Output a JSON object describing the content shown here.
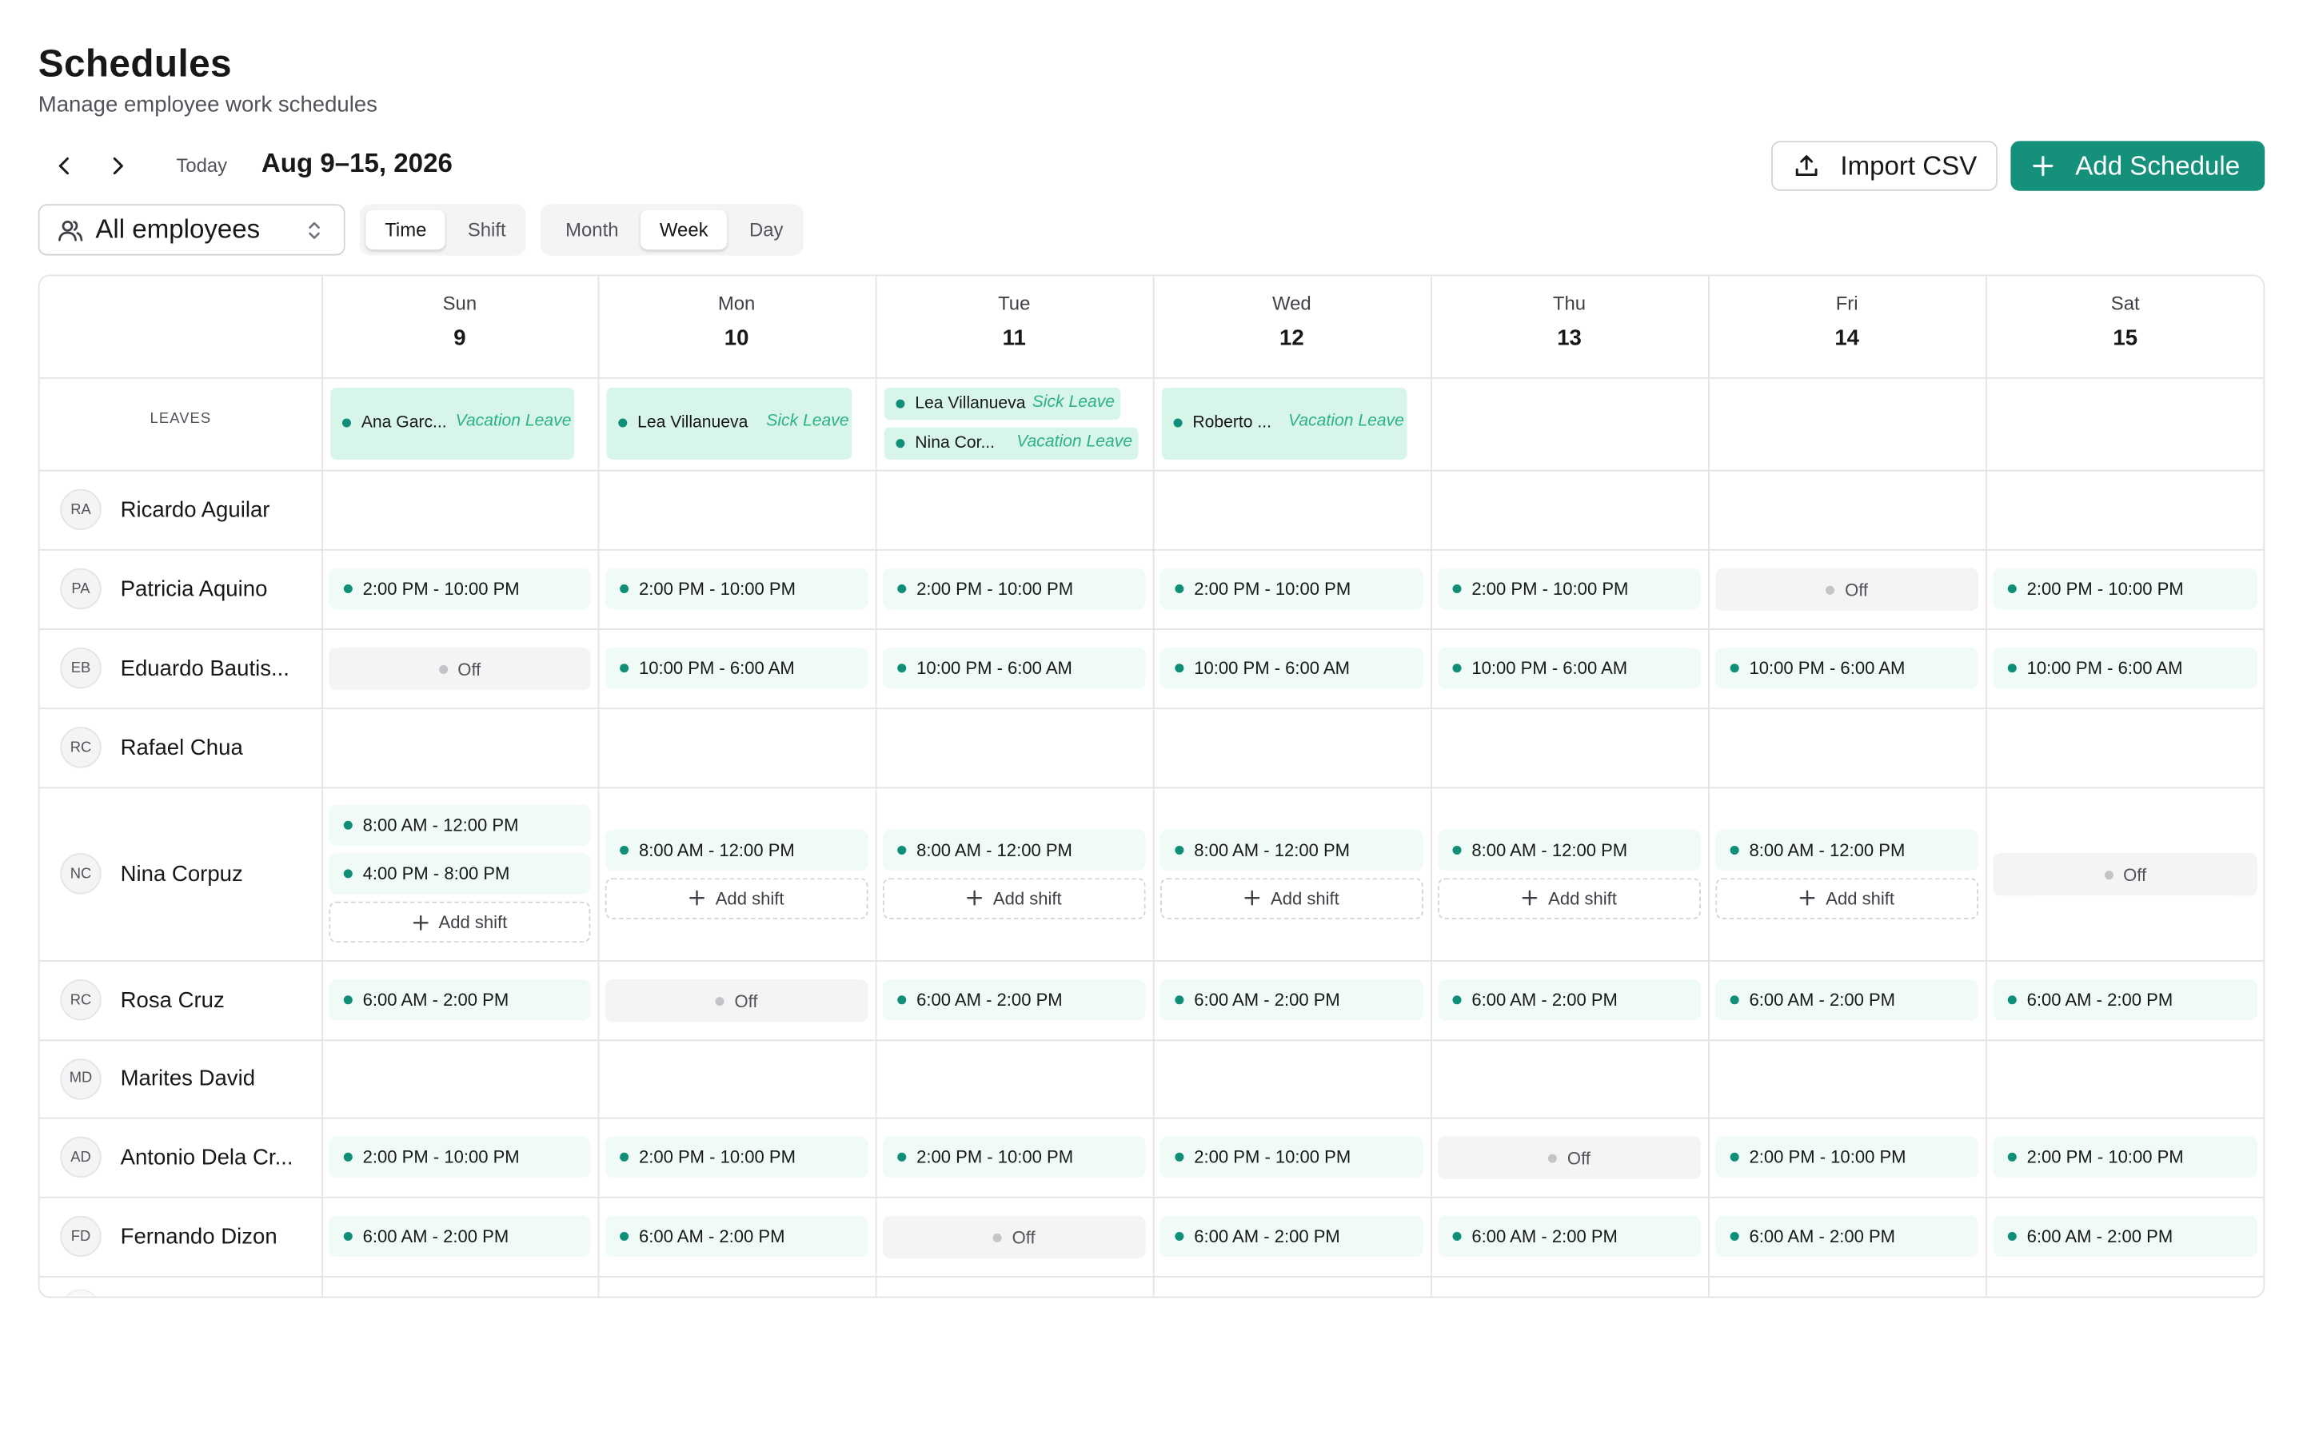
{
  "header": {
    "title": "Schedules",
    "subtitle": "Manage employee work schedules"
  },
  "nav": {
    "prev_icon": "chevron-left-icon",
    "next_icon": "chevron-right-icon",
    "today_label": "Today",
    "range": "Aug 9–15, 2026"
  },
  "actions": {
    "import_label": "Import CSV",
    "import_icon": "upload-icon",
    "add_label": "Add Schedule",
    "add_icon": "plus-icon"
  },
  "filters": {
    "employee_select": "All employees",
    "employee_icon": "users-icon",
    "view_mode": [
      {
        "label": "Time",
        "active": true
      },
      {
        "label": "Shift",
        "active": false
      }
    ],
    "period": [
      {
        "label": "Month",
        "active": false
      },
      {
        "label": "Week",
        "active": true
      },
      {
        "label": "Day",
        "active": false
      }
    ]
  },
  "colors": {
    "accent": "#14907b",
    "shift_bg": "#f0fbf8",
    "leave_bg": "#d7f5e8",
    "leave_type": "#2bb384",
    "off_bg": "#f4f4f5"
  },
  "days": [
    {
      "name": "Sun",
      "num": "9"
    },
    {
      "name": "Mon",
      "num": "10"
    },
    {
      "name": "Tue",
      "num": "11"
    },
    {
      "name": "Wed",
      "num": "12"
    },
    {
      "name": "Thu",
      "num": "13"
    },
    {
      "name": "Fri",
      "num": "14"
    },
    {
      "name": "Sat",
      "num": "15"
    }
  ],
  "leaves_label": "LEAVES",
  "leaves": [
    [
      {
        "name": "Ana Garc...",
        "type": "Vacation Leave"
      }
    ],
    [
      {
        "name": "Lea Villanueva",
        "type": "Sick Leave"
      }
    ],
    [
      {
        "name": "Lea Villanueva",
        "type": "Sick Leave"
      },
      {
        "name": "Nina Cor...",
        "type": "Vacation Leave"
      }
    ],
    [
      {
        "name": "Roberto ...",
        "type": "Vacation Leave"
      }
    ],
    [],
    [],
    []
  ],
  "add_shift_label": "Add shift",
  "off_label": "Off",
  "employees": [
    {
      "initials": "RA",
      "name": "Ricardo Aguilar",
      "days": [
        [],
        [],
        [],
        [],
        [],
        [],
        []
      ]
    },
    {
      "initials": "PA",
      "name": "Patricia Aquino",
      "days": [
        [
          "2:00 PM - 10:00 PM"
        ],
        [
          "2:00 PM - 10:00 PM"
        ],
        [
          "2:00 PM - 10:00 PM"
        ],
        [
          "2:00 PM - 10:00 PM"
        ],
        [
          "2:00 PM - 10:00 PM"
        ],
        "off",
        [
          "2:00 PM - 10:00 PM"
        ]
      ]
    },
    {
      "initials": "EB",
      "name": "Eduardo Bautis...",
      "days": [
        "off",
        [
          "10:00 PM - 6:00 AM"
        ],
        [
          "10:00 PM - 6:00 AM"
        ],
        [
          "10:00 PM - 6:00 AM"
        ],
        [
          "10:00 PM - 6:00 AM"
        ],
        [
          "10:00 PM - 6:00 AM"
        ],
        [
          "10:00 PM - 6:00 AM"
        ]
      ]
    },
    {
      "initials": "RC",
      "name": "Rafael Chua",
      "days": [
        [],
        [],
        [],
        [],
        [],
        [],
        []
      ]
    },
    {
      "initials": "NC",
      "name": "Nina Corpuz",
      "days": [
        [
          "8:00 AM - 12:00 PM",
          "4:00 PM - 8:00 PM"
        ],
        [
          "8:00 AM - 12:00 PM"
        ],
        [
          "8:00 AM - 12:00 PM"
        ],
        [
          "8:00 AM - 12:00 PM"
        ],
        [
          "8:00 AM - 12:00 PM"
        ],
        [
          "8:00 AM - 12:00 PM"
        ],
        "off"
      ],
      "add_shift": [
        true,
        true,
        true,
        true,
        true,
        true,
        false
      ]
    },
    {
      "initials": "RC",
      "name": "Rosa Cruz",
      "days": [
        [
          "6:00 AM - 2:00 PM"
        ],
        "off",
        [
          "6:00 AM - 2:00 PM"
        ],
        [
          "6:00 AM - 2:00 PM"
        ],
        [
          "6:00 AM - 2:00 PM"
        ],
        [
          "6:00 AM - 2:00 PM"
        ],
        [
          "6:00 AM - 2:00 PM"
        ]
      ]
    },
    {
      "initials": "MD",
      "name": "Marites David",
      "days": [
        [],
        [],
        [],
        [],
        [],
        [],
        []
      ]
    },
    {
      "initials": "AD",
      "name": "Antonio Dela Cr...",
      "days": [
        [
          "2:00 PM - 10:00 PM"
        ],
        [
          "2:00 PM - 10:00 PM"
        ],
        [
          "2:00 PM - 10:00 PM"
        ],
        [
          "2:00 PM - 10:00 PM"
        ],
        "off",
        [
          "2:00 PM - 10:00 PM"
        ],
        [
          "2:00 PM - 10:00 PM"
        ]
      ]
    },
    {
      "initials": "FD",
      "name": "Fernando Dizon",
      "days": [
        [
          "6:00 AM - 2:00 PM"
        ],
        [
          "6:00 AM - 2:00 PM"
        ],
        "off",
        [
          "6:00 AM - 2:00 PM"
        ],
        [
          "6:00 AM - 2:00 PM"
        ],
        [
          "6:00 AM - 2:00 PM"
        ],
        [
          "6:00 AM - 2:00 PM"
        ]
      ]
    }
  ]
}
